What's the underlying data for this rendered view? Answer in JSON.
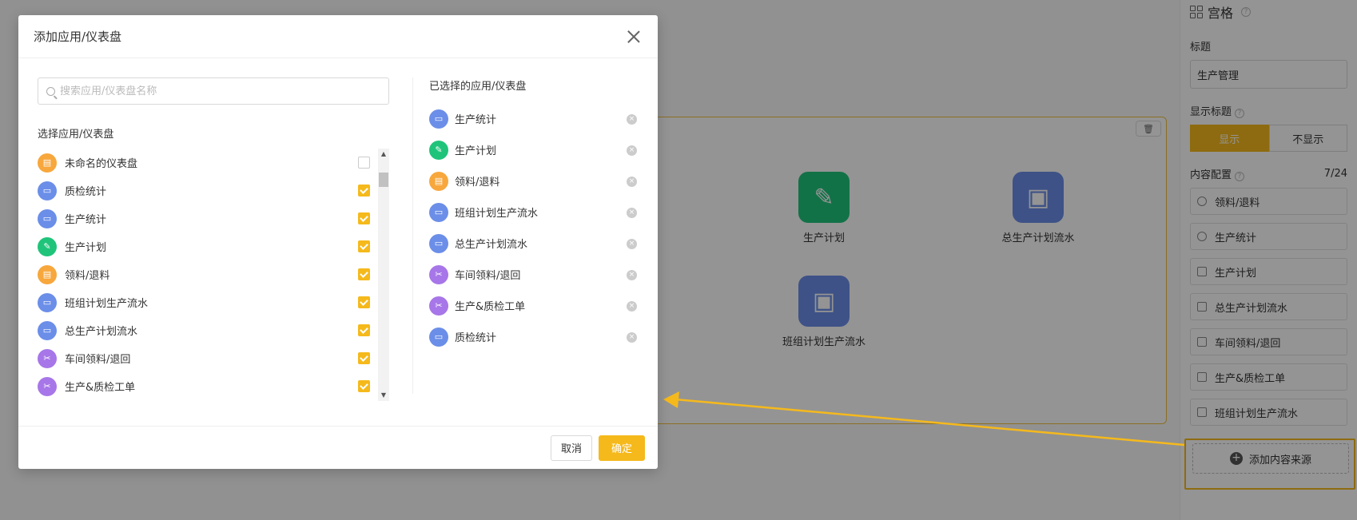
{
  "colors": {
    "accent": "#f5b91c",
    "blue": "#6b8ee8",
    "green": "#1fc47a",
    "orange": "#f7a73c",
    "purple": "#a776e8"
  },
  "right_panel": {
    "header": "宫格",
    "title_label": "标题",
    "title_value": "生产管理",
    "show_title_label": "显示标题",
    "show_on": "显示",
    "show_off": "不显示",
    "content_label": "内容配置",
    "content_count": "7/24",
    "sources": [
      {
        "label": "领料/退料",
        "icon": "clock"
      },
      {
        "label": "生产统计",
        "icon": "clock"
      },
      {
        "label": "生产计划",
        "icon": "doc"
      },
      {
        "label": "总生产计划流水",
        "icon": "doc"
      },
      {
        "label": "车间领料/退回",
        "icon": "doc"
      },
      {
        "label": "生产&质检工单",
        "icon": "doc"
      },
      {
        "label": "班组计划生产流水",
        "icon": "doc"
      }
    ],
    "add_source": "添加内容来源"
  },
  "canvas": {
    "tiles": [
      {
        "label": "生产计划",
        "icon": "pen-icon"
      },
      {
        "label": "总生产计划流水",
        "icon": "briefcase-icon"
      },
      {
        "label": "班组计划生产流水",
        "icon": "briefcase-icon"
      }
    ]
  },
  "modal": {
    "title": "添加应用/仪表盘",
    "search_placeholder": "搜索应用/仪表盘名称",
    "choose_title": "选择应用/仪表盘",
    "list": [
      {
        "label": "未命名的仪表盘",
        "color": "orange",
        "checked": false
      },
      {
        "label": "质检统计",
        "color": "blue",
        "checked": true
      },
      {
        "label": "生产统计",
        "color": "blue",
        "checked": true
      },
      {
        "label": "生产计划",
        "color": "green",
        "checked": true
      },
      {
        "label": "领料/退料",
        "color": "orange",
        "checked": true
      },
      {
        "label": "班组计划生产流水",
        "color": "blue",
        "checked": true
      },
      {
        "label": "总生产计划流水",
        "color": "blue",
        "checked": true
      },
      {
        "label": "车间领料/退回",
        "color": "purple",
        "checked": true
      },
      {
        "label": "生产&质检工单",
        "color": "purple",
        "checked": true
      }
    ],
    "selected_title": "已选择的应用/仪表盘",
    "selected": [
      {
        "label": "生产统计",
        "color": "blue"
      },
      {
        "label": "生产计划",
        "color": "green"
      },
      {
        "label": "领料/退料",
        "color": "orange"
      },
      {
        "label": "班组计划生产流水",
        "color": "blue"
      },
      {
        "label": "总生产计划流水",
        "color": "blue"
      },
      {
        "label": "车间领料/退回",
        "color": "purple"
      },
      {
        "label": "生产&质检工单",
        "color": "purple"
      },
      {
        "label": "质检统计",
        "color": "blue"
      }
    ],
    "cancel": "取消",
    "confirm": "确定"
  }
}
